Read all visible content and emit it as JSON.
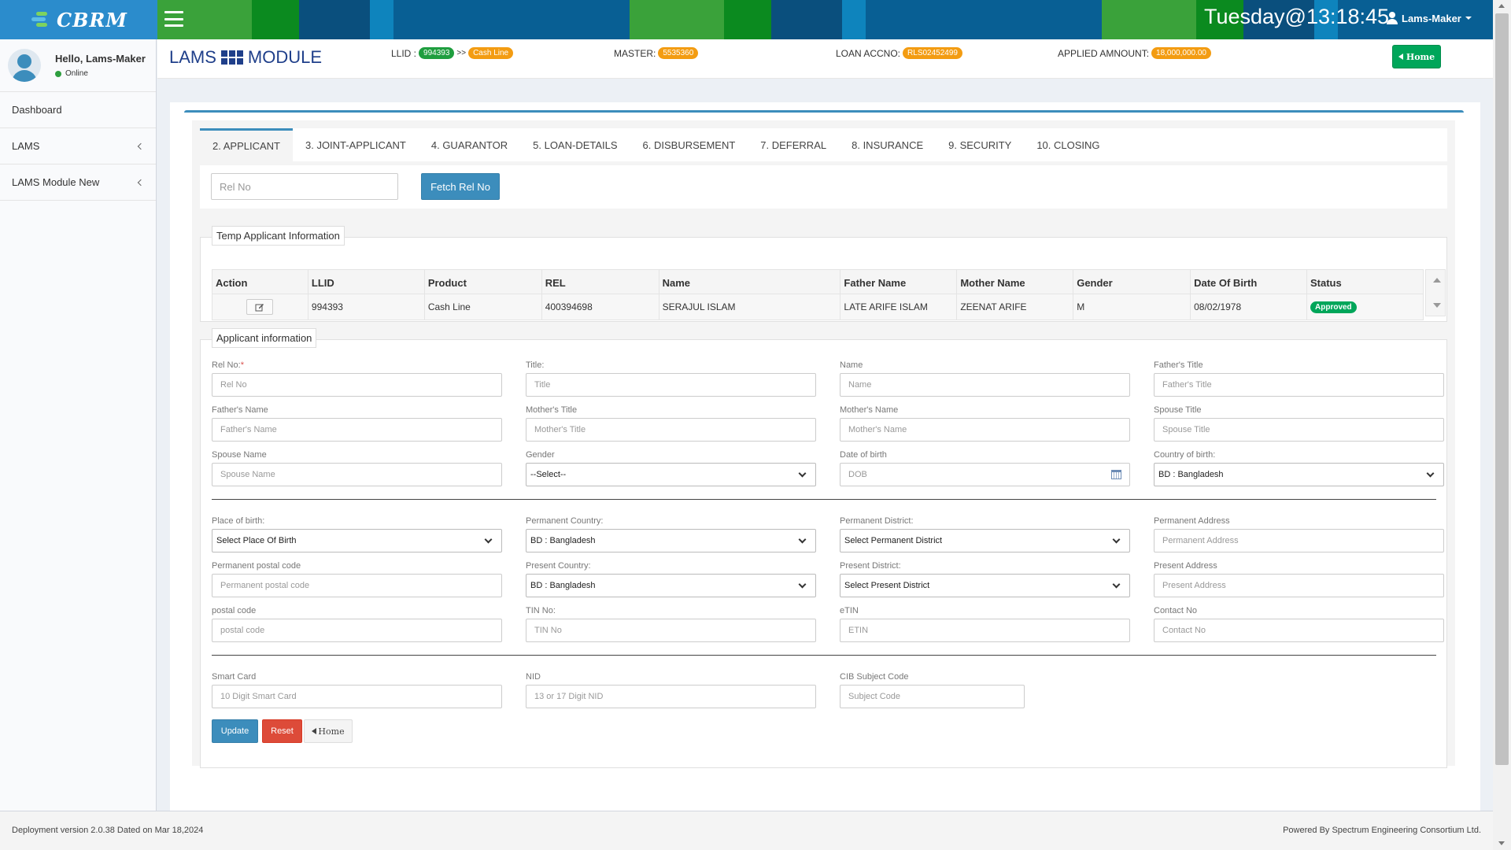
{
  "header": {
    "logo_text": "CBRM",
    "clock": "Tuesday@13:18:45",
    "user": "Lams-Maker"
  },
  "sidebar": {
    "greeting": "Hello, Lams-Maker",
    "status": "Online",
    "items": [
      {
        "label": "Dashboard"
      },
      {
        "label": "LAMS"
      },
      {
        "label": "LAMS Module New"
      }
    ]
  },
  "page": {
    "title_left": "LAMS",
    "title_right": "MODULE",
    "llid_label": "LLID :",
    "llid_value": "994393",
    "llid_arrow": ">>",
    "product": "Cash Line",
    "master_label": "MASTER:",
    "master_value": "5535360",
    "loan_label": "LOAN ACCNO:",
    "loan_value": "RLS02452499",
    "amount_label": "APPLIED AMNOUNT:",
    "amount_value": "18,000,000.00",
    "home_label": "Home"
  },
  "tabs": [
    {
      "label": "2. APPLICANT"
    },
    {
      "label": "3. JOINT-APPLICANT"
    },
    {
      "label": "4. GUARANTOR"
    },
    {
      "label": "5. LOAN-DETAILS"
    },
    {
      "label": "6. DISBURSEMENT"
    },
    {
      "label": "7. DEFERRAL"
    },
    {
      "label": "8. INSURANCE"
    },
    {
      "label": "9. SECURITY"
    },
    {
      "label": "10. CLOSING"
    }
  ],
  "fetch": {
    "placeholder": "Rel No",
    "button": "Fetch Rel No"
  },
  "temp_table": {
    "legend": "Temp Applicant Information",
    "columns": [
      "Action",
      "LLID",
      "Product",
      "REL",
      "Name",
      "Father Name",
      "Mother Name",
      "Gender",
      "Date Of Birth",
      "Status"
    ],
    "row": {
      "llid": "994393",
      "product": "Cash Line",
      "rel": "400394698",
      "name": "SERAJUL ISLAM",
      "father": "LATE ARIFE ISLAM",
      "mother": "ZEENAT ARIFE",
      "gender": "M",
      "dob": "08/02/1978",
      "status": "Approved"
    }
  },
  "form": {
    "legend": "Applicant information",
    "fields": {
      "rel_no": {
        "label": "Rel No:",
        "required": "*",
        "placeholder": "Rel No"
      },
      "title": {
        "label": "Title:",
        "placeholder": "Title"
      },
      "name": {
        "label": "Name",
        "placeholder": "Name"
      },
      "father_title": {
        "label": "Father's Title",
        "placeholder": "Father's Title"
      },
      "father_name": {
        "label": "Father's Name",
        "placeholder": "Father's Name"
      },
      "mother_title": {
        "label": "Mother's Title",
        "placeholder": "Mother's Title"
      },
      "mother_name": {
        "label": "Mother's Name",
        "placeholder": "Mother's Name"
      },
      "spouse_title": {
        "label": "Spouse Title",
        "placeholder": "Spouse Title"
      },
      "spouse_name": {
        "label": "Spouse Name",
        "placeholder": "Spouse Name"
      },
      "gender": {
        "label": "Gender",
        "value": "--Select--"
      },
      "dob": {
        "label": "Date of birth",
        "placeholder": "DOB"
      },
      "country_birth": {
        "label": "Country of birth:",
        "value": "BD : Bangladesh"
      },
      "place_birth": {
        "label": "Place of birth:",
        "value": "Select Place Of Birth"
      },
      "perm_country": {
        "label": "Permanent Country:",
        "value": "BD : Bangladesh"
      },
      "perm_district": {
        "label": "Permanent District:",
        "value": "Select Permanent District"
      },
      "perm_address": {
        "label": "Permanent Address",
        "placeholder": "Permanent Address"
      },
      "perm_postal": {
        "label": "Permanent postal code",
        "placeholder": "Permanent postal code"
      },
      "pres_country": {
        "label": "Present Country:",
        "value": "BD : Bangladesh"
      },
      "pres_district": {
        "label": "Present District:",
        "value": "Select Present District"
      },
      "pres_address": {
        "label": "Present Address",
        "placeholder": "Present Address"
      },
      "postal": {
        "label": "postal code",
        "placeholder": "postal code"
      },
      "tin": {
        "label": "TIN No:",
        "placeholder": "TIN No"
      },
      "etin": {
        "label": "eTIN",
        "placeholder": "ETIN"
      },
      "contact": {
        "label": "Contact No",
        "placeholder": "Contact No"
      },
      "smart_card": {
        "label": "Smart Card",
        "placeholder": "10 Digit Smart Card"
      },
      "nid": {
        "label": "NID",
        "placeholder": "13 or 17 Digit NID"
      },
      "cib": {
        "label": "CIB Subject Code",
        "placeholder": "Subject Code"
      }
    },
    "buttons": {
      "update": "Update",
      "reset": "Reset",
      "home": "Home"
    }
  },
  "footer": {
    "left": "Deployment version 2.0.38 Dated on Mar 18,2024",
    "right": "Powered By Spectrum Engineering Consortium Ltd."
  },
  "colors": {
    "primary": "#3c8dbc",
    "success": "#00a65a",
    "danger": "#dd4b39",
    "warning": "#f39c12"
  }
}
